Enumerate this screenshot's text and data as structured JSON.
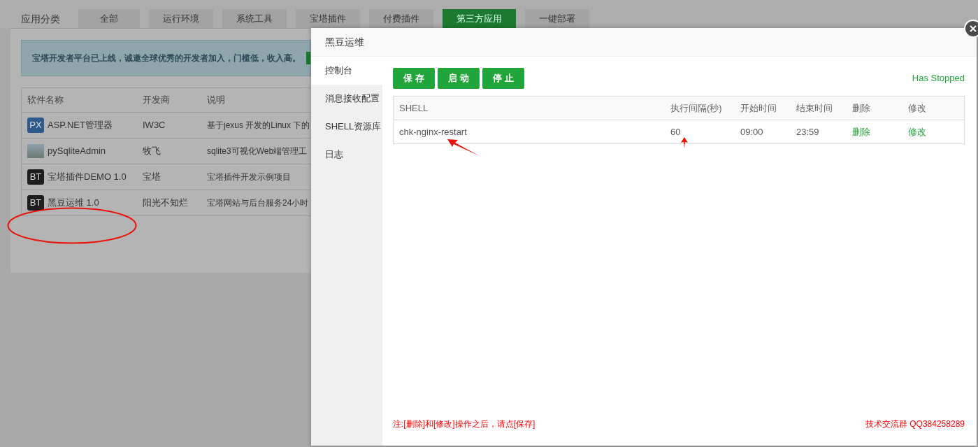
{
  "category_bar": {
    "label": "应用分类",
    "tabs": [
      {
        "label": "全部",
        "selected": false
      },
      {
        "label": "运行环境",
        "selected": false
      },
      {
        "label": "系统工具",
        "selected": false
      },
      {
        "label": "宝塔插件",
        "selected": false
      },
      {
        "label": "付费插件",
        "selected": false
      },
      {
        "label": "第三方应用",
        "selected": true
      },
      {
        "label": "一键部署",
        "selected": false
      }
    ]
  },
  "notice": {
    "text": "宝塔开发者平台已上线，诚邀全球优秀的开发者加入，门槛低，收入高。"
  },
  "software_table": {
    "columns": [
      "软件名称",
      "开发商",
      "说明"
    ],
    "rows": [
      {
        "kind": "logo",
        "logo": "PX",
        "color": "#2d5a8a",
        "name": "ASP.NET管理器",
        "vendor": "IW3C",
        "description": "基于jexus 开发的Linux 下的"
      },
      {
        "kind": "photo",
        "name": "pySqliteAdmin",
        "vendor": "牧飞",
        "description": "sqlite3可视化Web端管理工"
      },
      {
        "kind": "logo",
        "logo": "BT",
        "color": "#1e1e1e",
        "name": "宝塔插件DEMO 1.0",
        "vendor": "宝塔",
        "description": "宝塔插件开发示例项目"
      },
      {
        "kind": "logo",
        "logo": "BT",
        "color": "#1e1e1e",
        "name": "黑豆运维 1.0",
        "vendor": "阳光不知烂",
        "description": "宝塔网站与后台服务24小时"
      }
    ]
  },
  "dialog": {
    "title": "黑豆运维",
    "sidebar": {
      "items": [
        {
          "label": "控制台",
          "selected": true
        },
        {
          "label": "消息接收配置",
          "selected": false
        },
        {
          "label": "SHELL资源库",
          "selected": false
        },
        {
          "label": "日志",
          "selected": false
        }
      ]
    },
    "buttons": [
      "保 存",
      "启 动",
      "停 止"
    ],
    "status": "Has Stopped",
    "table": {
      "columns": [
        "SHELL",
        "执行间隔(秒)",
        "开始时间",
        "结束时间",
        "删除",
        "修改"
      ],
      "rows": [
        {
          "shell": "chk-nginx-restart",
          "interval": "60",
          "start": "09:00",
          "end": "23:59",
          "delete": "删除",
          "edit": "修改"
        }
      ]
    },
    "footer_note": "注:[删除]和[修改]操作之后，请点[保存]",
    "footer_contact": "技术交流群 QQ384258289"
  }
}
